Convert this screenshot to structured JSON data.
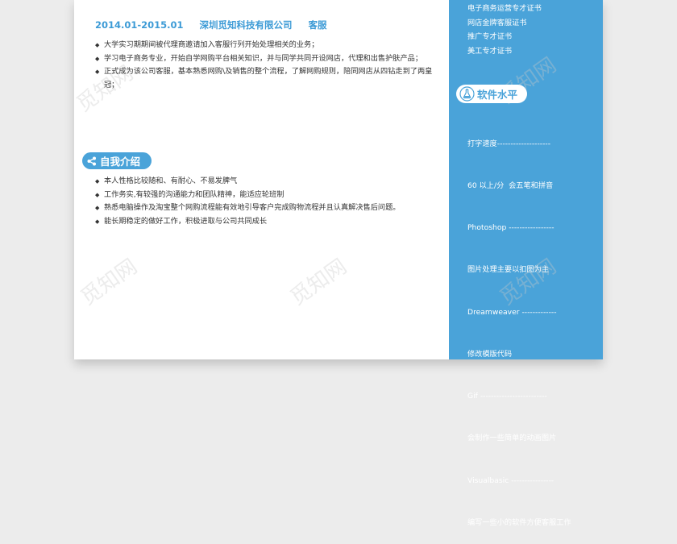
{
  "experience": {
    "period": "2014.01-2015.01",
    "company": "深圳觅知科技有限公司",
    "role": "客服",
    "bullets": [
      "大学实习期期间被代理商邀请加入客服行列开始处理相关的业务；",
      "学习电子商务专业，开始自学网购平台相关知识，并与同学共同开设网店，代理和出售护肤产品；",
      "正式成为该公司客服，基本熟悉网购\\及销售的整个流程，了解网购规则，陪同网店从四钻走到了两皇冠；"
    ]
  },
  "self_intro": {
    "title": "自我介绍",
    "icon": "share-icon",
    "bullets": [
      "本人性格比较随和、有耐心、不易发脾气",
      "工作务实,有较强的沟通能力和团队精神，能适应轮班制",
      "熟悉电脑操作及淘宝整个网购流程能有效地引导客户完成购物流程并且认真解决售后问题。",
      "能长期稳定的做好工作，积极进取与公司共同成长"
    ]
  },
  "sidebar": {
    "certificates": [
      "电子商务运营专才证书",
      "网店金牌客服证书",
      "推广专才证书",
      "美工专才证书"
    ],
    "software": {
      "title": "软件水平",
      "icon": "flask-icon",
      "lines": [
        "打字速度--------------------",
        "60 以上/分  会五笔和拼音",
        "Photoshop -----------------",
        "图片处理主要以扣图为主",
        "Dreamweaver -------------",
        "修改模版代码",
        "Gif -------------------------",
        "会制作一些简单的动画图片",
        "Visualbasic ----------------",
        "编写一些小的软件方便客服工作"
      ]
    }
  },
  "watermark_text": "觅知网",
  "colors": {
    "accent": "#4aa3d9",
    "header_text": "#3d9bd6",
    "body_text": "#333333"
  }
}
